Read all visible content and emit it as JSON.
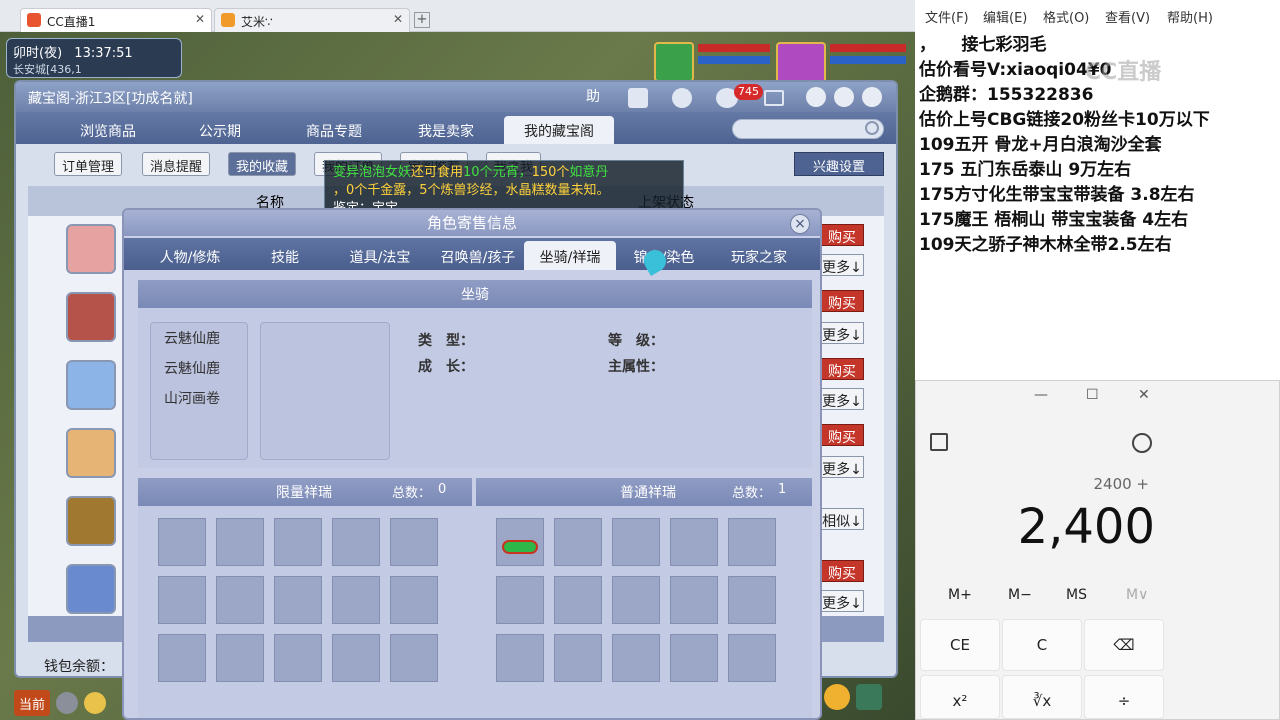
{
  "browser": {
    "tabs": [
      {
        "label": "CC直播1"
      },
      {
        "label": "艾米∵"
      }
    ],
    "new_tab": "+"
  },
  "game_hud": {
    "time": "卯时(夜)",
    "clock": "13:37:51",
    "location": "长安城[436,1",
    "bottom_label": "当前"
  },
  "window": {
    "title": "藏宝阁-浙江3区[功成名就]",
    "title_icons": [
      "助"
    ],
    "badge": "745",
    "nav": [
      "浏览商品",
      "公示期",
      "商品专题",
      "我是卖家",
      "我的藏宝阁"
    ],
    "sub": [
      "订单管理",
      "消息提醒",
      "我的收藏",
      "我的订单",
      "宝阁推荐",
      "我之我"
    ],
    "interest": "兴趣设置",
    "col_name": "名称",
    "col_status": "上架状态",
    "wallet": "钱包余额：",
    "rows": [
      {
        "btn": "购买",
        "more": "更多↓"
      },
      {
        "btn": "购买",
        "more": "更多↓"
      },
      {
        "btn": "购买",
        "more": "更多↓"
      },
      {
        "btn": "购买",
        "more": "更多↓"
      },
      {
        "btn": "",
        "more": "相似↓"
      },
      {
        "btn": "购买",
        "more": "更多↓"
      }
    ]
  },
  "tooltip": {
    "l1a": "变异泡泡女妖",
    "l1b": "还可食用",
    "l1c": "10个元宵，",
    "l1d": "150个",
    "l1e": "如意丹",
    "l2a": "，0个千金露，5个炼兽珍经，水晶糕数量未知。",
    "l3": "鉴定：宝宝"
  },
  "dialog": {
    "title": "角色寄售信息",
    "close": "×",
    "tabs": [
      "人物/修炼",
      "技能",
      "道具/法宝",
      "召唤兽/孩子",
      "坐骑/祥瑞",
      "锦衣/染色",
      "玩家之家"
    ],
    "section": "坐骑",
    "mounts": [
      "云魅仙鹿",
      "云魅仙鹿",
      "山河画卷"
    ],
    "type_label": "类　型：",
    "grade_label": "等　级：",
    "growth_label": "成　长：",
    "attr_label": "主属性：",
    "limited": {
      "title": "限量祥瑞",
      "total_label": "总数：",
      "total": "0"
    },
    "normal": {
      "title": "普通祥瑞",
      "total_label": "总数：",
      "total": "1"
    }
  },
  "notepad": {
    "menu": [
      "文件(F)",
      "编辑(E)",
      "格式(O)",
      "查看(V)",
      "帮助(H)"
    ],
    "lines": [
      "，　　接七彩羽毛",
      "估价看号V:xiaoqi04¥0",
      "企鹅群：155322836",
      "估价上号CBG链接20粉丝卡10万以下",
      "109五开 骨龙+月白浪淘沙全套",
      "175 五门东岳泰山  9万左右",
      "175方寸化生带宝宝带装备  3.8左右",
      "175魔王 梧桐山  带宝宝装备 4左右",
      "109天之骄子神木林全带2.5左右"
    ],
    "watermark": "CC直播"
  },
  "calculator": {
    "expression": "2400 +",
    "display": "2,400",
    "memory": [
      "M+",
      "M−",
      "MS",
      "M∨"
    ],
    "keys": [
      "CE",
      "C",
      "⌫",
      "x²",
      "∛x",
      "÷"
    ],
    "win_min": "—",
    "win_max": "☐",
    "win_close": "✕"
  }
}
